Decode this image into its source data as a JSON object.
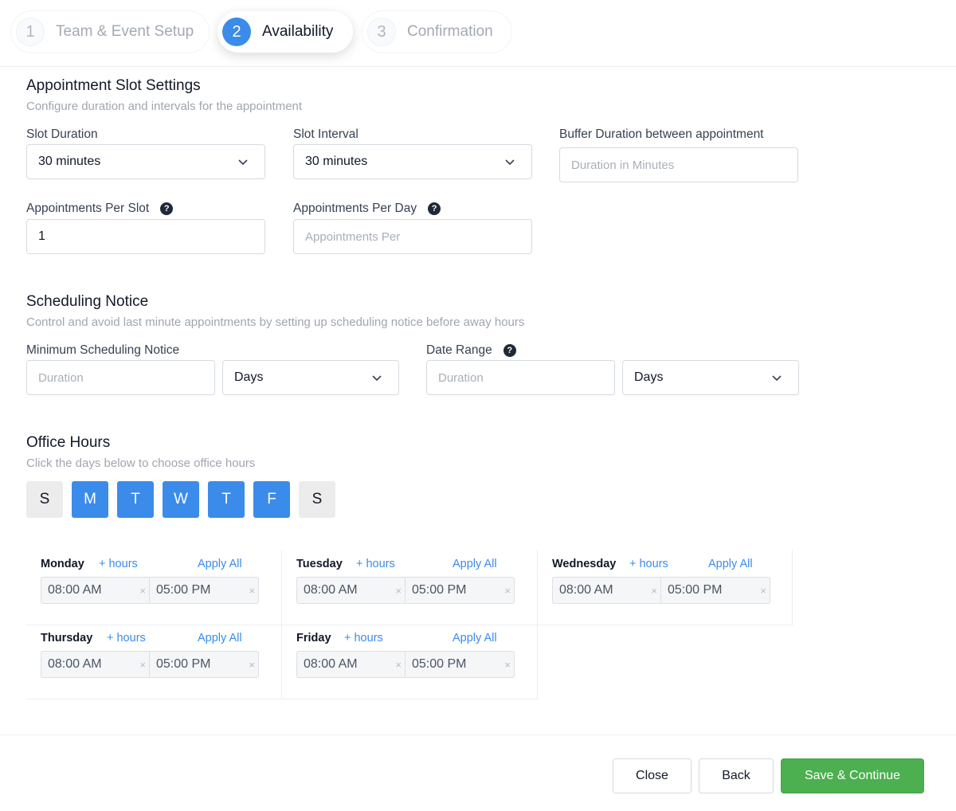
{
  "stepper": [
    {
      "num": "1",
      "label": "Team & Event Setup"
    },
    {
      "num": "2",
      "label": "Availability"
    },
    {
      "num": "3",
      "label": "Confirmation"
    }
  ],
  "slot_settings": {
    "title": "Appointment Slot Settings",
    "subtitle": "Configure duration and intervals for the appointment",
    "slot_duration": {
      "label": "Slot Duration",
      "value": "30 minutes"
    },
    "slot_interval": {
      "label": "Slot Interval",
      "value": "30 minutes"
    },
    "buffer": {
      "label": "Buffer Duration between appointment",
      "placeholder": "Duration in Minutes"
    },
    "per_slot": {
      "label": "Appointments Per Slot",
      "value": "1"
    },
    "per_day": {
      "label": "Appointments Per Day",
      "placeholder": "Appointments Per"
    }
  },
  "scheduling": {
    "title": "Scheduling Notice",
    "subtitle": "Control and avoid last minute appointments by setting up scheduling notice before away hours",
    "min_notice": {
      "label": "Minimum Scheduling Notice",
      "placeholder": "Duration",
      "unit": "Days"
    },
    "date_range": {
      "label": "Date Range",
      "placeholder": "Duration",
      "unit": "Days"
    }
  },
  "office_hours": {
    "title": "Office Hours",
    "subtitle": "Click the days below to choose office hours",
    "days": [
      {
        "letter": "S",
        "selected": false
      },
      {
        "letter": "M",
        "selected": true
      },
      {
        "letter": "T",
        "selected": true
      },
      {
        "letter": "W",
        "selected": true
      },
      {
        "letter": "T",
        "selected": true
      },
      {
        "letter": "F",
        "selected": true
      },
      {
        "letter": "S",
        "selected": false
      }
    ],
    "add_hours_label": "+ hours",
    "apply_all_label": "Apply All",
    "schedule": [
      {
        "day": "Monday",
        "start": "08:00 AM",
        "end": "05:00 PM"
      },
      {
        "day": "Tuesday",
        "start": "08:00 AM",
        "end": "05:00 PM"
      },
      {
        "day": "Wednesday",
        "start": "08:00 AM",
        "end": "05:00 PM"
      },
      {
        "day": "Thursday",
        "start": "08:00 AM",
        "end": "05:00 PM"
      },
      {
        "day": "Friday",
        "start": "08:00 AM",
        "end": "05:00 PM"
      }
    ],
    "clear_glyph": "×"
  },
  "footer": {
    "close": "Close",
    "back": "Back",
    "save": "Save & Continue"
  },
  "colors": {
    "accent": "#3b8beb",
    "success": "#4caf50"
  }
}
